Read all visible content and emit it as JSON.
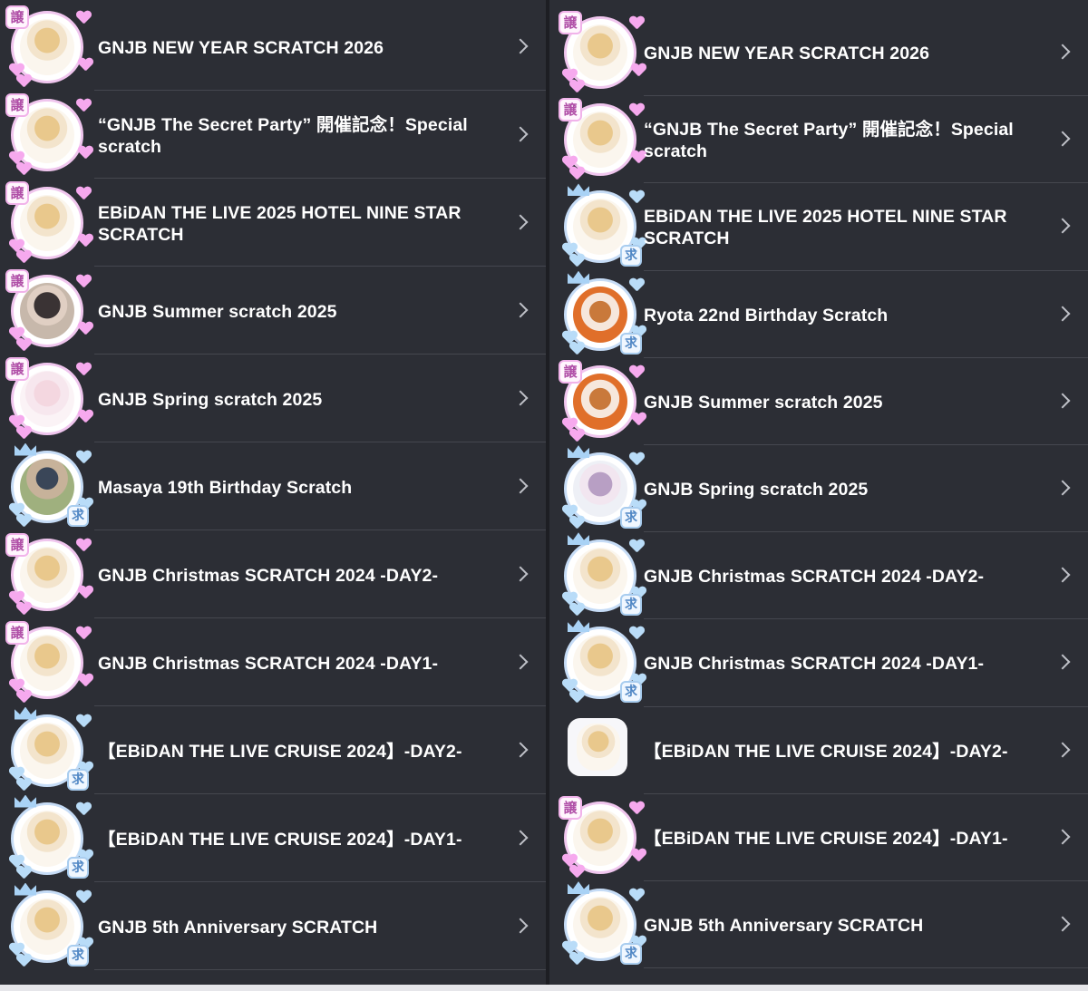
{
  "left": {
    "items": [
      {
        "title": "GNJB NEW YEAR SCRATCH 2026",
        "badge": "譲",
        "badge2": "",
        "style": "pink",
        "photo": "",
        "crown": false
      },
      {
        "title": "“GNJB The Secret Party” 開催記念！Special scratch",
        "badge": "譲",
        "badge2": "",
        "style": "pink",
        "photo": "",
        "crown": false
      },
      {
        "title": "EBiDAN THE LIVE 2025 HOTEL NINE STAR SCRATCH",
        "badge": "譲",
        "badge2": "",
        "style": "pink",
        "photo": "",
        "crown": false
      },
      {
        "title": "GNJB Summer scratch 2025",
        "badge": "譲",
        "badge2": "",
        "style": "pink",
        "photo": "dark",
        "crown": false
      },
      {
        "title": "GNJB Spring scratch 2025",
        "badge": "譲",
        "badge2": "",
        "style": "pink",
        "photo": "pink",
        "crown": false
      },
      {
        "title": "Masaya 19th Birthday Scratch",
        "badge": "",
        "badge2": "求",
        "style": "blue",
        "photo": "cap",
        "crown": true
      },
      {
        "title": "GNJB Christmas SCRATCH 2024 -DAY2-",
        "badge": "譲",
        "badge2": "",
        "style": "pink",
        "photo": "",
        "crown": false
      },
      {
        "title": "GNJB Christmas SCRATCH 2024 -DAY1-",
        "badge": "譲",
        "badge2": "",
        "style": "pink",
        "photo": "",
        "crown": false
      },
      {
        "title": "【EBiDAN THE LIVE CRUISE 2024】-DAY2-",
        "badge": "",
        "badge2": "求",
        "style": "blue",
        "photo": "",
        "crown": true
      },
      {
        "title": "【EBiDAN THE LIVE CRUISE 2024】-DAY1-",
        "badge": "",
        "badge2": "求",
        "style": "blue",
        "photo": "",
        "crown": true
      },
      {
        "title": "GNJB 5th Anniversary SCRATCH",
        "badge": "",
        "badge2": "求",
        "style": "blue",
        "photo": "",
        "crown": true
      }
    ]
  },
  "right": {
    "items": [
      {
        "title": "GNJB NEW YEAR SCRATCH 2026",
        "badge": "譲",
        "badge2": "",
        "style": "pink",
        "photo": "",
        "crown": false
      },
      {
        "title": "“GNJB The Secret Party” 開催記念！Special scratch",
        "badge": "譲",
        "badge2": "",
        "style": "pink",
        "photo": "",
        "crown": false
      },
      {
        "title": "EBiDAN THE LIVE 2025 HOTEL NINE STAR SCRATCH",
        "badge": "",
        "badge2": "求",
        "style": "blue",
        "photo": "",
        "crown": true
      },
      {
        "title": "Ryota 22nd Birthday Scratch",
        "badge": "",
        "badge2": "求",
        "style": "blue",
        "photo": "orange",
        "crown": true
      },
      {
        "title": "GNJB Summer scratch 2025",
        "badge": "譲",
        "badge2": "",
        "style": "pink",
        "photo": "orange",
        "crown": false
      },
      {
        "title": "GNJB Spring scratch 2025",
        "badge": "",
        "badge2": "求",
        "style": "blue",
        "photo": "lav",
        "crown": true
      },
      {
        "title": "GNJB Christmas SCRATCH 2024 -DAY2-",
        "badge": "",
        "badge2": "求",
        "style": "blue",
        "photo": "",
        "crown": true
      },
      {
        "title": "GNJB Christmas SCRATCH 2024 -DAY1-",
        "badge": "",
        "badge2": "求",
        "style": "blue",
        "photo": "",
        "crown": true
      },
      {
        "title": "【EBiDAN THE LIVE CRUISE 2024】-DAY2-",
        "badge": "",
        "badge2": "",
        "style": "square",
        "photo": "",
        "crown": false
      },
      {
        "title": "【EBiDAN THE LIVE CRUISE 2024】-DAY1-",
        "badge": "譲",
        "badge2": "",
        "style": "pink",
        "photo": "",
        "crown": false
      },
      {
        "title": "GNJB 5th Anniversary SCRATCH",
        "badge": "",
        "badge2": "求",
        "style": "blue",
        "photo": "",
        "crown": true
      }
    ]
  }
}
